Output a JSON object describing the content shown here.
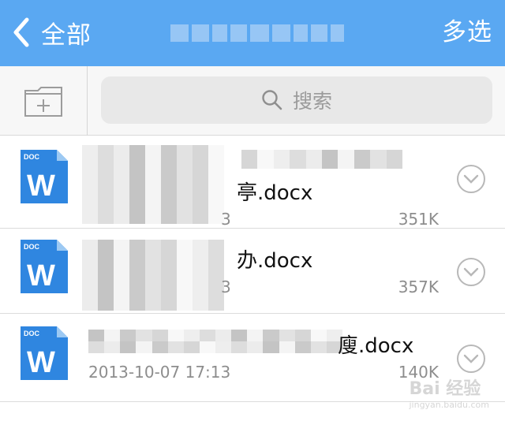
{
  "header": {
    "back_label": "全部",
    "action_label": "多选",
    "bg_color": "#5aa8f2"
  },
  "toolbar": {
    "new_folder_icon": "folder-add-icon",
    "search_placeholder": "搜索"
  },
  "files": [
    {
      "name": "亭.docx",
      "date": "3",
      "size": "351K",
      "icon": "word-doc-icon"
    },
    {
      "name": "办.docx",
      "date": "3",
      "size": "357K",
      "icon": "word-doc-icon"
    },
    {
      "name": "廋.docx",
      "date": "2013-10-07 17:13",
      "size": "140K",
      "icon": "word-doc-icon"
    }
  ],
  "watermark": {
    "main": "Bai 经验",
    "sub": "jingyan.baidu.com"
  }
}
